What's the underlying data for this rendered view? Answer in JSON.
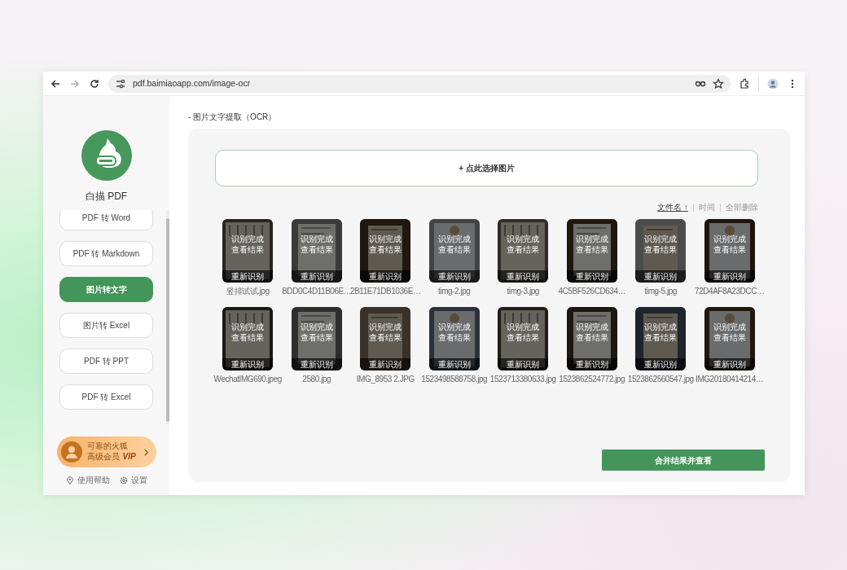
{
  "browser": {
    "url": "pdf.baimiaoapp.com/image-ocr"
  },
  "sidebar": {
    "brand": "白描 PDF",
    "items": [
      {
        "label": "PDF 转 Word",
        "selected": false
      },
      {
        "label": "PDF 转 Markdown",
        "selected": false
      },
      {
        "label": "图片转文字",
        "selected": true
      },
      {
        "label": "图片转 Excel",
        "selected": false
      },
      {
        "label": "PDF 转 PPT",
        "selected": false
      },
      {
        "label": "PDF 转 Excel",
        "selected": false
      }
    ],
    "user": {
      "name": "可靠的火狐",
      "tier": "高级会员",
      "badge": "VIP"
    },
    "footer": [
      {
        "kind": "help",
        "label": "使用帮助"
      },
      {
        "kind": "settings",
        "label": "设置"
      }
    ]
  },
  "page": {
    "breadcrumb": "- 图片文字提取（OCR）",
    "upload": "+ 点此选择图片",
    "sort": [
      {
        "label": "文件名",
        "direction": "↑",
        "selected": true
      },
      {
        "label": "时间",
        "selected": false
      }
    ],
    "delete_all": "全部删除",
    "files": [
      {
        "name": "竖排试试.jpg",
        "status": "识别完成",
        "view": "查看结果",
        "retry": "重新识别"
      },
      {
        "name": "BDD0C4D11B06E…",
        "status": "识别完成",
        "view": "查看结果",
        "retry": "重新识别"
      },
      {
        "name": "2B11E71DB1036E…",
        "status": "识别完成",
        "view": "查看结果",
        "retry": "重新识别"
      },
      {
        "name": "timg-2.jpg",
        "status": "识别完成",
        "view": "查看结果",
        "retry": "重新识别"
      },
      {
        "name": "timg-3.jpg",
        "status": "识别完成",
        "view": "查看结果",
        "retry": "重新识别"
      },
      {
        "name": "4C5BF526CD634…",
        "status": "识别完成",
        "view": "查看结果",
        "retry": "重新识别"
      },
      {
        "name": "timg-5.jpg",
        "status": "识别完成",
        "view": "查看结果",
        "retry": "重新识别"
      },
      {
        "name": "72D4AF8A23DCC…",
        "status": "识别完成",
        "view": "查看结果",
        "retry": "重新识别"
      },
      {
        "name": "WechatIMG690.jpeg",
        "status": "识别完成",
        "view": "查看结果",
        "retry": "重新识别"
      },
      {
        "name": "2580.jpg",
        "status": "识别完成",
        "view": "查看结果",
        "retry": "重新识别"
      },
      {
        "name": "IMG_8953 2.JPG",
        "status": "识别完成",
        "view": "查看结果",
        "retry": "重新识别"
      },
      {
        "name": "1523498588758.jpg",
        "status": "识别完成",
        "view": "查看结果",
        "retry": "重新识别"
      },
      {
        "name": "1523713380633.jpg",
        "status": "识别完成",
        "view": "查看结果",
        "retry": "重新识别"
      },
      {
        "name": "1523862524772.jpg",
        "status": "识别完成",
        "view": "查看结果",
        "retry": "重新识别"
      },
      {
        "name": "1523862560547.jpg",
        "status": "识别完成",
        "view": "查看结果",
        "retry": "重新识别"
      },
      {
        "name": "IMG20180414214…",
        "status": "识别完成",
        "view": "查看结果",
        "retry": "重新识别"
      }
    ],
    "merge": "合并结果并查看"
  }
}
